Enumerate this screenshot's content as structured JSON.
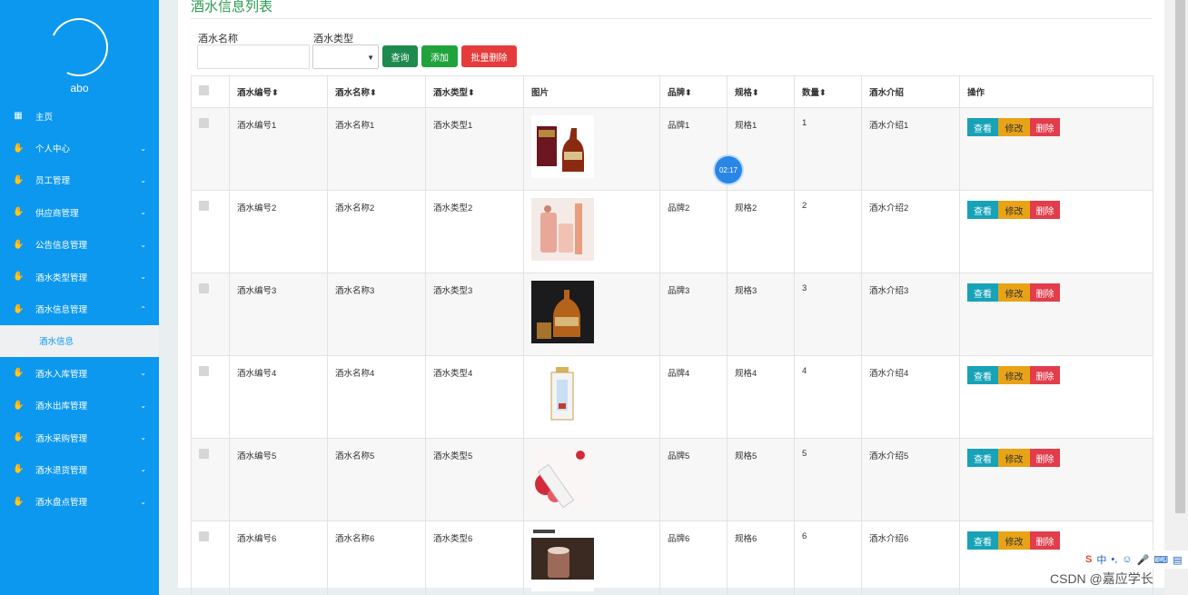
{
  "sidebar": {
    "username": "abo",
    "menu": [
      {
        "label": "主页",
        "icon": "grid-icon"
      },
      {
        "label": "个人中心",
        "icon": "hand-icon"
      },
      {
        "label": "员工管理",
        "icon": "hand-icon"
      },
      {
        "label": "供应商管理",
        "icon": "hand-icon"
      },
      {
        "label": "公告信息管理",
        "icon": "hand-icon"
      },
      {
        "label": "酒水类型管理",
        "icon": "hand-icon"
      },
      {
        "label": "酒水信息管理",
        "icon": "hand-icon"
      },
      {
        "label": "酒水入库管理",
        "icon": "hand-icon"
      },
      {
        "label": "酒水出库管理",
        "icon": "hand-icon"
      },
      {
        "label": "酒水采购管理",
        "icon": "hand-icon"
      },
      {
        "label": "酒水退货管理",
        "icon": "hand-icon"
      },
      {
        "label": "酒水盘点管理",
        "icon": "hand-icon"
      }
    ],
    "active_sub": "酒水信息"
  },
  "page": {
    "title": "酒水信息列表",
    "search_name_label": "酒水名称",
    "search_type_label": "酒水类型",
    "search_name_value": "",
    "search_type_value": "",
    "btn_query": "查询",
    "btn_add": "添加",
    "btn_batch_delete": "批量删除"
  },
  "table": {
    "headers": [
      "酒水编号",
      "酒水名称",
      "酒水类型",
      "图片",
      "品牌",
      "规格",
      "数量",
      "酒水介绍",
      "操作"
    ],
    "sortable": [
      true,
      true,
      true,
      false,
      true,
      true,
      true,
      false,
      false
    ],
    "rows": [
      {
        "code": "酒水编号1",
        "name": "酒水名称1",
        "type": "酒水类型1",
        "brand": "品牌1",
        "spec": "规格1",
        "qty": "1",
        "intro": "酒水介绍1"
      },
      {
        "code": "酒水编号2",
        "name": "酒水名称2",
        "type": "酒水类型2",
        "brand": "品牌2",
        "spec": "规格2",
        "qty": "2",
        "intro": "酒水介绍2"
      },
      {
        "code": "酒水编号3",
        "name": "酒水名称3",
        "type": "酒水类型3",
        "brand": "品牌3",
        "spec": "规格3",
        "qty": "3",
        "intro": "酒水介绍3"
      },
      {
        "code": "酒水编号4",
        "name": "酒水名称4",
        "type": "酒水类型4",
        "brand": "品牌4",
        "spec": "规格4",
        "qty": "4",
        "intro": "酒水介绍4"
      },
      {
        "code": "酒水编号5",
        "name": "酒水名称5",
        "type": "酒水类型5",
        "brand": "品牌5",
        "spec": "规格5",
        "qty": "5",
        "intro": "酒水介绍5"
      },
      {
        "code": "酒水编号6",
        "name": "酒水名称6",
        "type": "酒水类型6",
        "brand": "品牌6",
        "spec": "规格6",
        "qty": "6",
        "intro": "酒水介绍6"
      }
    ],
    "actions": {
      "view": "查看",
      "edit": "修改",
      "delete": "删除"
    }
  },
  "overlay": {
    "timer": "02:17",
    "ime_label": "中",
    "watermark": "CSDN @嘉应学长"
  },
  "colors": {
    "sidebar_bg": "#0d98ef",
    "title_green": "#2e9a52",
    "btn_query": "#1e8a4f",
    "btn_add": "#21a33b",
    "btn_delete": "#e53b3b",
    "view": "#17a2b8",
    "edit": "#e8a317",
    "remove": "#e23d4b"
  }
}
